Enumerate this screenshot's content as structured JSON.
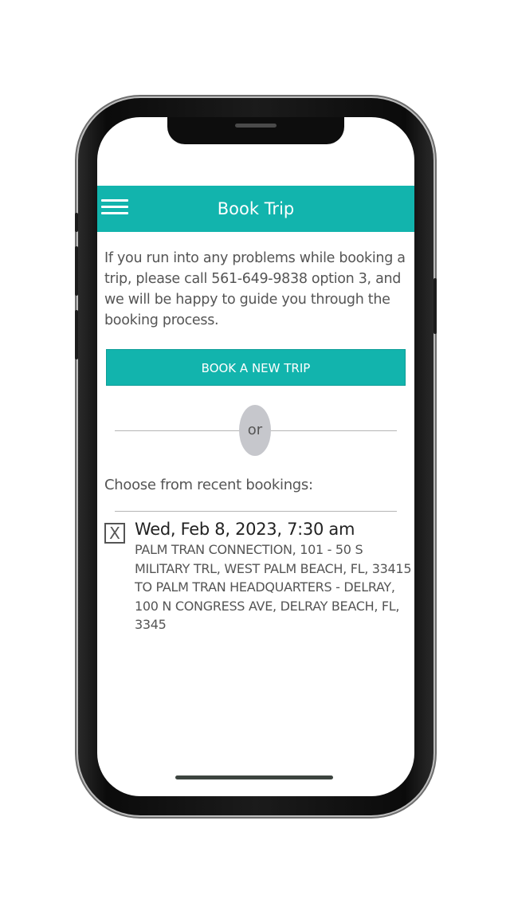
{
  "header": {
    "title": "Book Trip",
    "menu_icon": "hamburger-menu-icon"
  },
  "help": {
    "text": "If you run into any problems while booking a trip, please call 561-649-9838 option 3,  and we will be happy to guide you through the booking process."
  },
  "actions": {
    "book_new_trip_label": "BOOK A NEW TRIP",
    "divider_label": "or"
  },
  "recent": {
    "title": "Choose from recent bookings:",
    "bookings": [
      {
        "remove_label": "X",
        "date": "Wed, Feb 8, 2023, 7:30 am",
        "route": "PALM TRAN CONNECTION, 101 - 50 S MILITARY TRL, WEST PALM BEACH, FL, 33415 TO PALM TRAN HEADQUARTERS - DELRAY, 100 N CONGRESS AVE, DELRAY BEACH, FL, 3345"
      }
    ]
  },
  "colors": {
    "accent": "#12b4ad",
    "text": "#555555",
    "divider_bubble": "#c6c7cc"
  }
}
